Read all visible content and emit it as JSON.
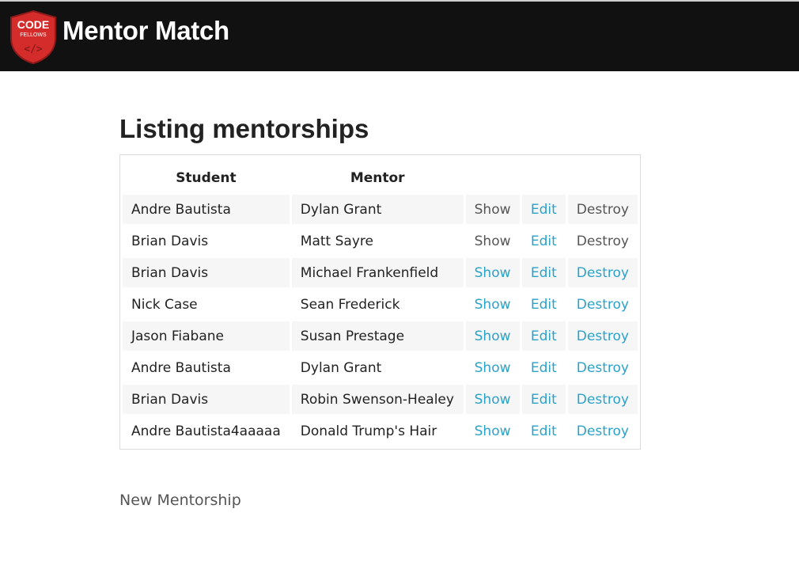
{
  "header": {
    "logo_line1": "CODE",
    "logo_line2": "FELLOWS",
    "logo_glyph": "</>",
    "title": "Mentor Match"
  },
  "page": {
    "title": "Listing mentorships"
  },
  "table": {
    "headers": [
      "Student",
      "Mentor"
    ],
    "rows": [
      {
        "student": "Andre Bautista",
        "mentor": "Dylan Grant",
        "show": "Show",
        "edit": "Edit",
        "destroy": "Destroy"
      },
      {
        "student": "Brian Davis",
        "mentor": "Matt Sayre",
        "show": "Show",
        "edit": "Edit",
        "destroy": "Destroy"
      },
      {
        "student": "Brian Davis",
        "mentor": "Michael Frankenfield",
        "show": "Show",
        "edit": "Edit",
        "destroy": "Destroy"
      },
      {
        "student": "Nick Case",
        "mentor": "Sean Frederick",
        "show": "Show",
        "edit": "Edit",
        "destroy": "Destroy"
      },
      {
        "student": "Jason Fiabane",
        "mentor": "Susan Prestage",
        "show": "Show",
        "edit": "Edit",
        "destroy": "Destroy"
      },
      {
        "student": "Andre Bautista",
        "mentor": "Dylan Grant",
        "show": "Show",
        "edit": "Edit",
        "destroy": "Destroy"
      },
      {
        "student": "Brian Davis",
        "mentor": "Robin Swenson-Healey",
        "show": "Show",
        "edit": "Edit",
        "destroy": "Destroy"
      },
      {
        "student": "Andre Bautista4aaaaa",
        "mentor": "Donald Trump's Hair",
        "show": "Show",
        "edit": "Edit",
        "destroy": "Destroy"
      }
    ]
  },
  "footer": {
    "new_link": "New Mentorship"
  },
  "colors": {
    "topbar": "#111111",
    "link": "#2aa2c9",
    "link_muted": "#555555",
    "logo_red": "#d42b2b"
  },
  "icons": {
    "logo": "code-fellows-shield-logo"
  }
}
